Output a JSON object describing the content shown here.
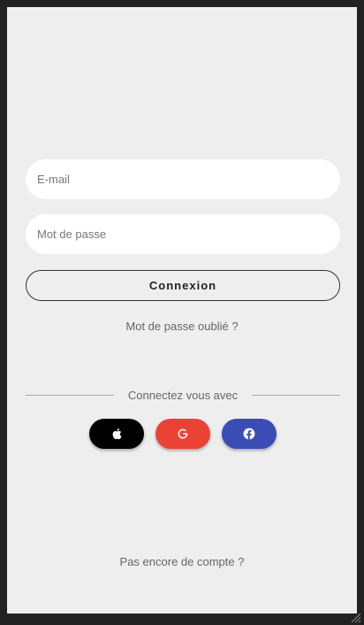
{
  "form": {
    "email_placeholder": "E-mail",
    "password_placeholder": "Mot de passe",
    "login_label": "Connexion",
    "forgot_password": "Mot de passe oublié ?"
  },
  "social": {
    "divider_label": "Connectez vous avec",
    "buttons": [
      {
        "icon": "apple-icon",
        "color": "#000000"
      },
      {
        "icon": "google-icon",
        "color": "#ea4335"
      },
      {
        "icon": "facebook-icon",
        "color": "#3b4db5"
      }
    ]
  },
  "footer": {
    "signup_link": "Pas encore de compte ?"
  }
}
